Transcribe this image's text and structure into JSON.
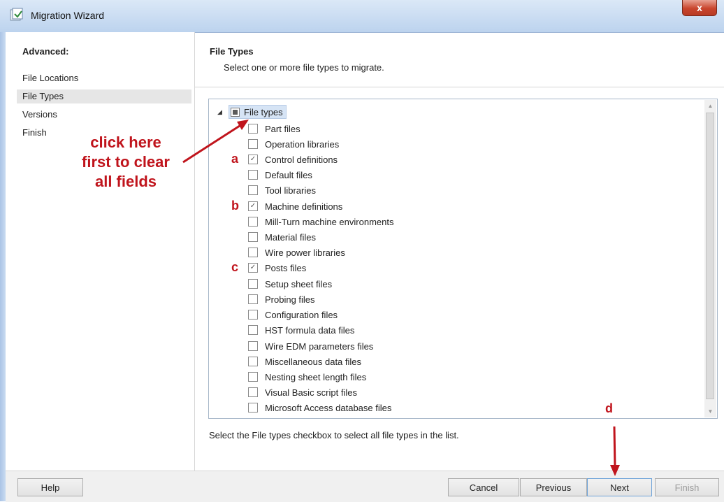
{
  "window": {
    "title": "Migration Wizard",
    "close_label": "x"
  },
  "sidebar": {
    "header": "Advanced:",
    "items": [
      {
        "label": "File Locations",
        "selected": false
      },
      {
        "label": "File Types",
        "selected": true
      },
      {
        "label": "Versions",
        "selected": false
      },
      {
        "label": "Finish",
        "selected": false
      }
    ]
  },
  "main": {
    "title": "File Types",
    "subtitle": "Select one or more file types to migrate.",
    "tree": {
      "root_label": "File types",
      "items": [
        {
          "label": "Part files",
          "checked": false
        },
        {
          "label": "Operation libraries",
          "checked": false
        },
        {
          "label": "Control definitions",
          "checked": true
        },
        {
          "label": "Default files",
          "checked": false
        },
        {
          "label": "Tool libraries",
          "checked": false
        },
        {
          "label": "Machine definitions",
          "checked": true
        },
        {
          "label": "Mill-Turn machine environments",
          "checked": false
        },
        {
          "label": "Material files",
          "checked": false
        },
        {
          "label": "Wire power libraries",
          "checked": false
        },
        {
          "label": "Posts files",
          "checked": true
        },
        {
          "label": "Setup sheet files",
          "checked": false
        },
        {
          "label": "Probing files",
          "checked": false
        },
        {
          "label": "Configuration files",
          "checked": false
        },
        {
          "label": "HST formula data files",
          "checked": false
        },
        {
          "label": "Wire EDM parameters files",
          "checked": false
        },
        {
          "label": "Miscellaneous data files",
          "checked": false
        },
        {
          "label": "Nesting sheet length files",
          "checked": false
        },
        {
          "label": "Visual Basic script files",
          "checked": false
        },
        {
          "label": "Microsoft Access database files",
          "checked": false
        }
      ]
    },
    "hint": "Select the File types checkbox to select all file types in the list."
  },
  "buttons": {
    "help": "Help",
    "cancel": "Cancel",
    "previous": "Previous",
    "next": "Next",
    "finish": "Finish"
  },
  "annotations": {
    "callout_lines": [
      "click here",
      "first to clear",
      "all fields"
    ],
    "a": "a",
    "b": "b",
    "c": "c",
    "d": "d"
  },
  "colors": {
    "annotation": "#c0141c",
    "titlebar": "#c9dbf1",
    "close": "#c9452d"
  }
}
